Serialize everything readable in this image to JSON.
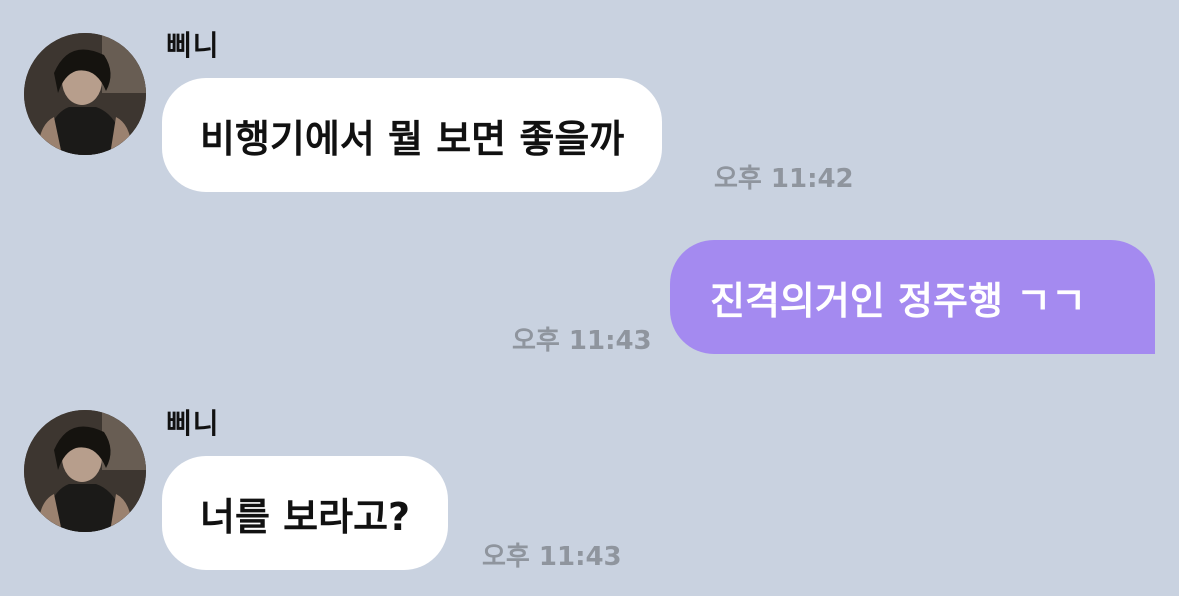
{
  "colors": {
    "background": "#c9d2e0",
    "incoming_bubble": "#ffffff",
    "outgoing_bubble": "#a48af0",
    "timestamp": "#8f959e"
  },
  "messages": [
    {
      "direction": "incoming",
      "sender": "삐니",
      "avatar": "profile-photo",
      "text": "비행기에서 뭘 보면 좋을까",
      "time": "오후 11:42"
    },
    {
      "direction": "outgoing",
      "text": "진격의거인 정주행 ㄱㄱ",
      "time": "오후 11:43"
    },
    {
      "direction": "incoming",
      "sender": "삐니",
      "avatar": "profile-photo",
      "text": "너를 보라고?",
      "time": "오후 11:43"
    }
  ]
}
